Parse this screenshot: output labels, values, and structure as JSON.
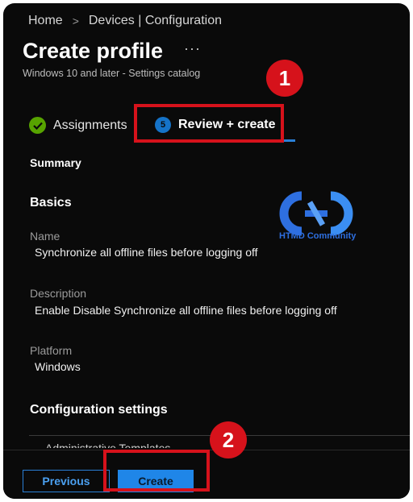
{
  "breadcrumb": {
    "home": "Home",
    "separator": ">",
    "current": "Devices | Configuration"
  },
  "header": {
    "title": "Create profile",
    "more": "···",
    "subtitle": "Windows 10 and later - Settings catalog"
  },
  "tabs": [
    {
      "label": "Assignments",
      "icon": "check-icon",
      "state": "complete"
    },
    {
      "label": "Review + create",
      "step": "5",
      "icon": "step-icon",
      "state": "active"
    }
  ],
  "summary": {
    "heading": "Summary",
    "basics_heading": "Basics",
    "name_label": "Name",
    "name_value": "Synchronize all offline files before logging off",
    "description_label": "Description",
    "description_value": "Enable Disable Synchronize all offline files before logging off",
    "platform_label": "Platform",
    "platform_value": "Windows",
    "config_heading": "Configuration settings",
    "cut_off_text": "Administrative Templates"
  },
  "watermark": {
    "logo_text": "HTMD Community",
    "icon": "htmd-logo"
  },
  "annotations": {
    "marker_1": "1",
    "marker_2": "2"
  },
  "footer": {
    "previous_label": "Previous",
    "create_label": "Create"
  },
  "colors": {
    "background": "#0a0a0a",
    "accent": "#1f86e8",
    "success": "#57a300",
    "annotation": "#d6121b"
  }
}
